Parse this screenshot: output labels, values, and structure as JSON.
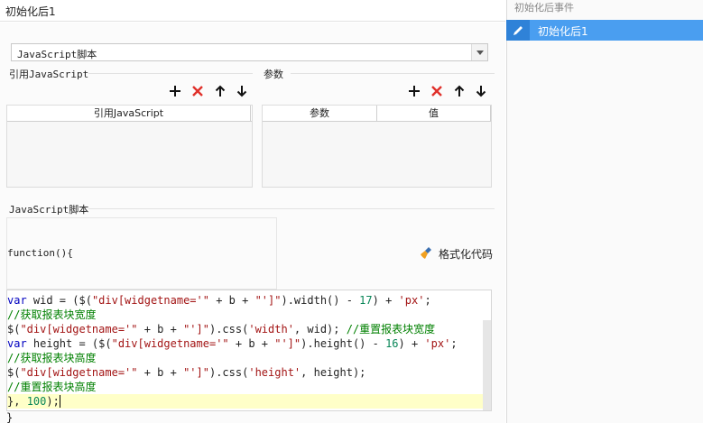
{
  "title": "初始化后1",
  "script_type": {
    "selected": "JavaScript脚本"
  },
  "ref_section": {
    "title": "引用JavaScript",
    "column": "引用JavaScript"
  },
  "param_section": {
    "title": "参数",
    "columns": [
      "参数",
      "值"
    ]
  },
  "script_section": {
    "title": "JavaScript脚本",
    "function_header": "function(){",
    "format_button": "格式化代码",
    "code_lines": [
      "var wid = ($(\"div[widgetname='\" + b + \"']\").width() - 17) + 'px';",
      "//获取报表块宽度",
      "$(\"div[widgetname='\" + b + \"']\").css('width', wid); //重置报表块宽度",
      "var height = ($(\"div[widgetname='\" + b + \"']\").height() - 16) + 'px';",
      "//获取报表块高度",
      "$(\"div[widgetname='\" + b + \"']\").css('height', height);",
      "//重置报表块高度",
      "}, 100);"
    ],
    "closing": "}"
  },
  "events_panel": {
    "header": "初始化后事件",
    "items": [
      {
        "label": "初始化后1",
        "selected": true
      }
    ]
  },
  "colors": {
    "accent": "#4a9ef0",
    "delete": "#e0302a",
    "comment": "#008000",
    "string": "#a31515",
    "keyword": "#0000c0"
  }
}
